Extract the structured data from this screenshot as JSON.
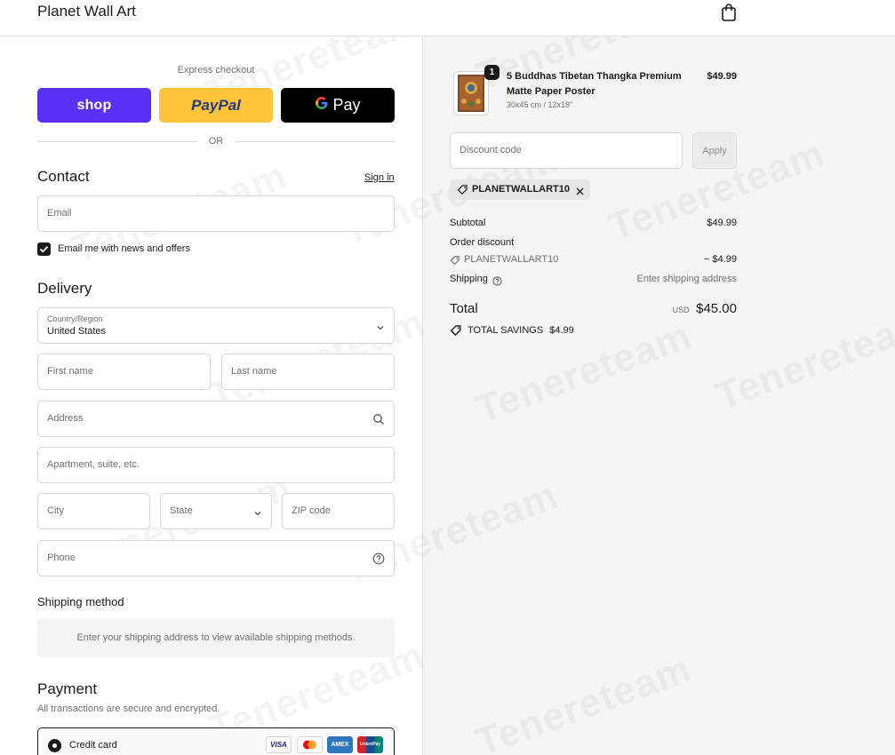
{
  "header": {
    "store_name": "Planet Wall Art",
    "cart_icon": "shopping-bag-icon"
  },
  "express": {
    "title": "Express checkout",
    "shop_label": "shop",
    "paypal_label": "PayPal",
    "gpay_label": "Pay",
    "or_label": "OR",
    "colors": {
      "shop": "#5a31f4",
      "paypal": "#ffc439",
      "gpay": "#000000"
    }
  },
  "contact": {
    "title": "Contact",
    "sign_in": "Sign in",
    "email_placeholder": "Email",
    "newsletter_label": "Email me with news and offers",
    "newsletter_checked": true
  },
  "delivery": {
    "title": "Delivery",
    "country_label": "Country/Region",
    "country_value": "United States",
    "first_name": "First name",
    "last_name": "Last name",
    "address": "Address",
    "apartment": "Apartment, suite, etc.",
    "city": "City",
    "state": "State",
    "zip": "ZIP code",
    "phone": "Phone"
  },
  "shipping_method": {
    "title": "Shipping method",
    "notice": "Enter your shipping address to view available shipping methods."
  },
  "payment": {
    "title": "Payment",
    "subtitle": "All transactions are secure and encrypted.",
    "method_label": "Credit card",
    "cards": [
      "VISA",
      "mastercard",
      "AMEX",
      "UnionPay"
    ]
  },
  "summary": {
    "item": {
      "quantity": "1",
      "name_line1": "5 Buddhas Tibetan Thangka Premium",
      "name_line2": "Matte Paper Poster",
      "variant": "30x45 cm / 12x18\"",
      "price": "$49.99"
    },
    "discount_placeholder": "Discount code",
    "apply_label": "Apply",
    "applied_code": "PLANETWALLART10",
    "subtotal_label": "Subtotal",
    "subtotal_value": "$49.99",
    "order_discount_label": "Order discount",
    "discount_code": "PLANETWALLART10",
    "discount_value": "− $4.99",
    "shipping_label": "Shipping",
    "shipping_value": "Enter shipping address",
    "total_label": "Total",
    "currency": "USD",
    "total_value": "$45.00",
    "savings_label": "TOTAL SAVINGS",
    "savings_value": "$4.99"
  },
  "watermark": "Tenereteam"
}
